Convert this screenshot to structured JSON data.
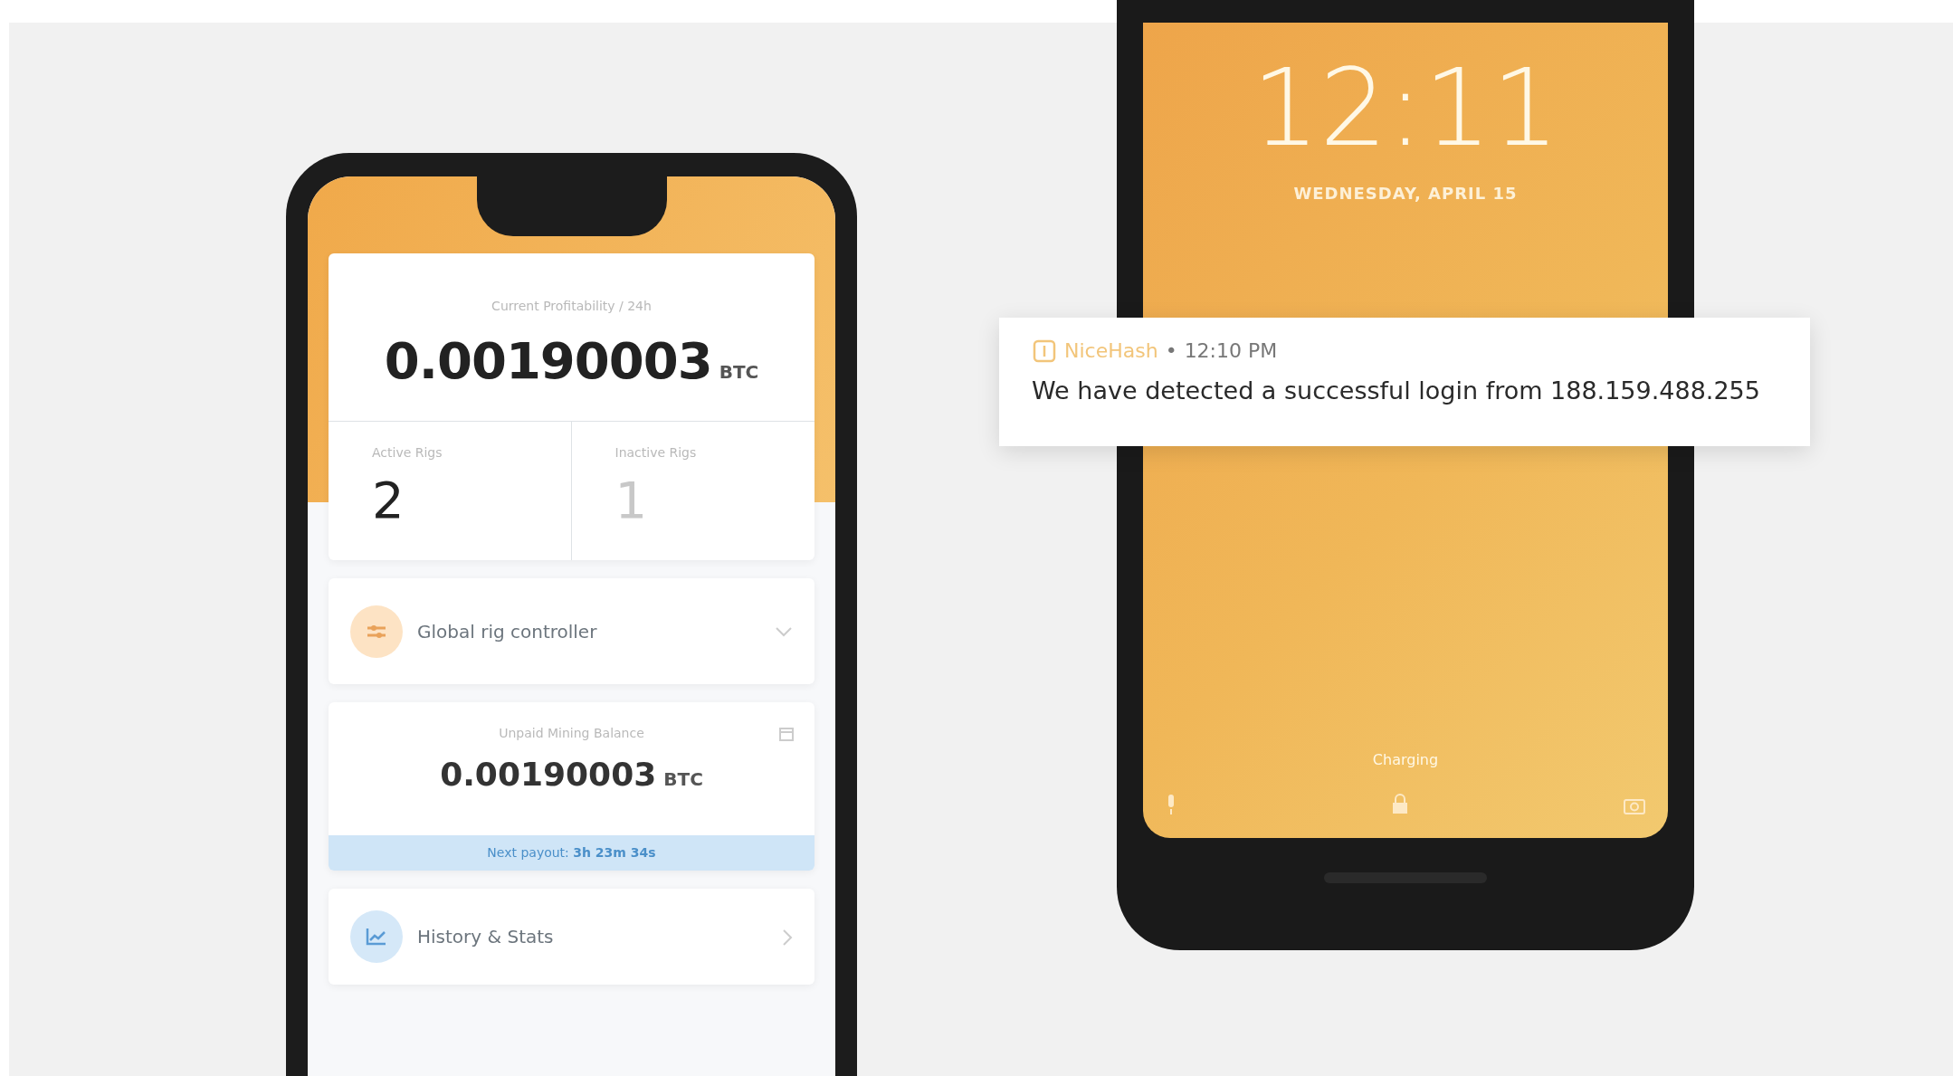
{
  "app_phone": {
    "profitability": {
      "label": "Current Profitability / 24h",
      "amount": "0.00190003",
      "unit": "BTC"
    },
    "rigs": [
      {
        "label": "Active Rigs",
        "count": "2",
        "active": true
      },
      {
        "label": "Inactive Rigs",
        "count": "1",
        "active": false
      }
    ],
    "rig_controller": {
      "label": "Global rig controller"
    },
    "balance": {
      "label": "Unpaid Mining Balance",
      "amount": "0.00190003",
      "unit": "BTC",
      "payout_label": "Next payout:",
      "payout_time": "3h 23m 34s"
    },
    "history": {
      "label": "History & Stats"
    }
  },
  "lock_phone": {
    "time": "12:11",
    "date": "WEDNESDAY, APRIL 15",
    "charging": "Charging"
  },
  "notification": {
    "app": "NiceHash",
    "separator": "•",
    "time": "12:10 PM",
    "message": "We have detected a successful login from 188.159.488.255"
  }
}
